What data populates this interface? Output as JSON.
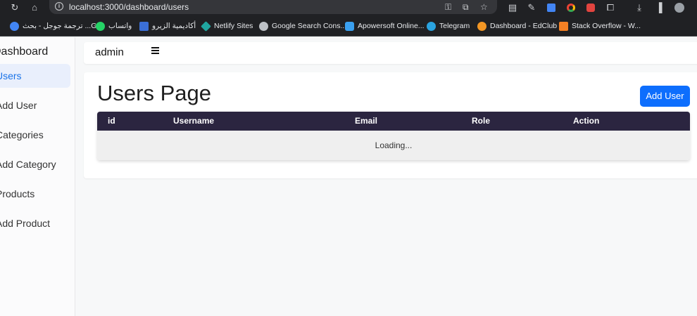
{
  "browser": {
    "url": "localhost:3000/dashboard/users",
    "bookmarks": [
      {
        "label": "ترجمة جوجل - بحث ...G",
        "icon": "google-icon",
        "color": "#4285f4"
      },
      {
        "label": "واتساب",
        "icon": "whatsapp-icon",
        "color": "#25d366"
      },
      {
        "label": "أكاديمية الزيرو",
        "icon": "e-logo-icon",
        "color": "#3b6fd6"
      },
      {
        "label": "Netlify Sites",
        "icon": "netlify-icon",
        "color": "#20a6a0"
      },
      {
        "label": "Google Search Cons...",
        "icon": "globe-icon",
        "color": "#bdc1c6"
      },
      {
        "label": "Apowersoft Online...",
        "icon": "apowersoft-icon",
        "color": "#3aa0f0"
      },
      {
        "label": "Telegram",
        "icon": "telegram-icon",
        "color": "#2aa3e0"
      },
      {
        "label": "Dashboard - EdClub",
        "icon": "edclub-icon",
        "color": "#f29624"
      },
      {
        "label": "Stack Overflow - W...",
        "icon": "stackoverflow-icon",
        "color": "#f48024"
      }
    ]
  },
  "sidebar": {
    "brand": "Dashboard",
    "items": [
      {
        "label": "Users",
        "active": true
      },
      {
        "label": "Add User",
        "active": false
      },
      {
        "label": "Categories",
        "active": false
      },
      {
        "label": "Add Category",
        "active": false
      },
      {
        "label": "Products",
        "active": false
      },
      {
        "label": "Add Product",
        "active": false
      }
    ]
  },
  "topbar": {
    "user": "admin",
    "menu_icon": "hamburger-icon"
  },
  "main": {
    "title": "Users Page",
    "add_button": "Add User",
    "table": {
      "columns": [
        "id",
        "Username",
        "Email",
        "Role",
        "Action"
      ],
      "status": "Loading..."
    }
  },
  "colors": {
    "accent": "#0d6efd",
    "table_header": "#2b2540",
    "active_nav": "#1a73e8"
  }
}
